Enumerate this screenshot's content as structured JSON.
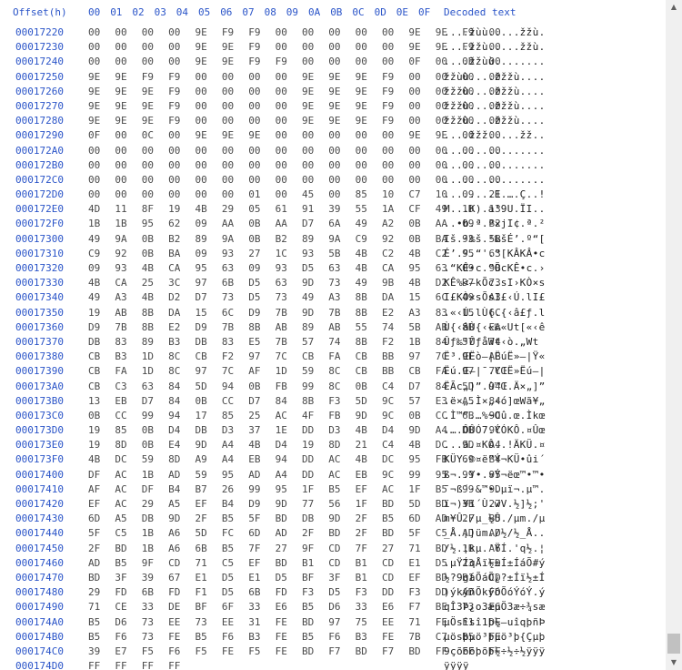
{
  "header": {
    "offset_label": "Offset(h)",
    "columns": [
      "00",
      "01",
      "02",
      "03",
      "04",
      "05",
      "06",
      "07",
      "08",
      "09",
      "0A",
      "0B",
      "0C",
      "0D",
      "0E",
      "0F"
    ],
    "decoded_label": "Decoded text"
  },
  "rows": [
    {
      "offset": "00017220",
      "bytes": "00 00 00 00 9E F9 F9 00 00 00 00 00 9E 9E F9 00",
      "decoded": "....žùù.....žžù."
    },
    {
      "offset": "00017230",
      "bytes": "00 00 00 00 9E 9E F9 00 00 00 00 00 9E 9E F9 00",
      "decoded": "....žžù.....žžù."
    },
    {
      "offset": "00017240",
      "bytes": "00 00 00 00 9E 9E F9 F9 00 00 00 00 0F 00 0B 00",
      "decoded": "....žžùù........"
    },
    {
      "offset": "00017250",
      "bytes": "9E 9E F9 F9 00 00 00 00 9E 9E 9E F9 00 00 00 00",
      "decoded": "žžùù....žžžù...."
    },
    {
      "offset": "00017260",
      "bytes": "9E 9E 9E F9 00 00 00 00 9E 9E 9E F9 00 00 00 00",
      "decoded": "žžžù....žžžù...."
    },
    {
      "offset": "00017270",
      "bytes": "9E 9E 9E F9 00 00 00 00 9E 9E 9E F9 00 00 00 00",
      "decoded": "žžžù....žžžù...."
    },
    {
      "offset": "00017280",
      "bytes": "9E 9E 9E F9 00 00 00 00 9E 9E 9E F9 00 00 00 00",
      "decoded": "žžžù....žžžù...."
    },
    {
      "offset": "00017290",
      "bytes": "0F 00 0C 00 9E 9E 9E 00 00 00 00 00 9E 9E 00 00",
      "decoded": "....žžž.....žž.."
    },
    {
      "offset": "000172A0",
      "bytes": "00 00 00 00 00 00 00 00 00 00 00 00 00 00 00 00",
      "decoded": "................"
    },
    {
      "offset": "000172B0",
      "bytes": "00 00 00 00 00 00 00 00 00 00 00 00 00 00 00 00",
      "decoded": "................"
    },
    {
      "offset": "000172C0",
      "bytes": "00 00 00 00 00 00 00 00 00 00 00 00 00 00 00 00",
      "decoded": "................"
    },
    {
      "offset": "000172D0",
      "bytes": "00 00 00 00 00 00 01 00 45 00 85 10 C7 10 09 21",
      "decoded": "........E.….Ç..!"
    },
    {
      "offset": "000172E0",
      "bytes": "4D 11 8F 19 4B 29 05 61 91 39 55 1A CF 49 1D 13",
      "decoded": "M...K).a‘9U.ÏI.."
    },
    {
      "offset": "000172F0",
      "bytes": "1B 1B 95 62 09 AA 0B AA D7 6A 49 A2 0B AA 09 B2",
      "decoded": "..•b.ª.ª×jI¢.ª.²"
    },
    {
      "offset": "00017300",
      "bytes": "49 9A 0B B2 89 9A 0B B2 89 9A C9 92 0B BA 93 5B",
      "decoded": "Iš.²‰š.²‰šÉ’.º“["
    },
    {
      "offset": "00017310",
      "bytes": "C9 92 0B BA 09 93 27 1C 93 5B 4B C2 4B C2 95 63",
      "decoded": "É’.º.“'.“[KÂKÂ•c"
    },
    {
      "offset": "00017320",
      "bytes": "09 93 4B CA 95 63 09 93 D5 63 4B CA 95 63 09 9B",
      "decoded": ".“KÊ•c.“ÕcKÊ•c.›"
    },
    {
      "offset": "00017330",
      "bytes": "4B CA 25 3C 97 6B D5 63 9D 73 49 9B 4B D2 D7 73",
      "decoded": "KÊ%<—kÕc.sI›KÒ×s"
    },
    {
      "offset": "00017340",
      "bytes": "49 A3 4B D2 D7 73 D5 73 49 A3 8B DA 15 6C 49 A3",
      "decoded": "I£KÒ×sÕsI£‹Ú.lI£"
    },
    {
      "offset": "00017350",
      "bytes": "19 AB 8B DA 15 6C D9 7B 9D 7B 8B E2 A3 83 15 6C",
      "decoded": ".«‹Ú.lÙ{.{‹â£ƒ.l"
    },
    {
      "offset": "00017360",
      "bytes": "D9 7B 8B E2 D9 7B 8B AB 89 AB 55 74 5B AB 8B EA",
      "decoded": "Ù{‹âÙ{‹«‰«Ut[«‹ê"
    },
    {
      "offset": "00017370",
      "bytes": "DB 83 89 B3 DB 83 E5 7B 57 74 8B F2 1B 84 57 74",
      "decoded": "Ûƒ‰³ÛƒåWt‹ò.„Wt"
    },
    {
      "offset": "00017380",
      "bytes": "CB B3 1D 8C CB F2 97 7C CB FA CB BB 97 7C 9F AB",
      "decoded": "Ë³.ŒËò—|ËúË»—|Ÿ«"
    },
    {
      "offset": "00017390",
      "bytes": "CB FA 1D 8C 97 7C AF 1D 59 8C CB BB CB FA 97 7C",
      "decoded": "Ëú.Œ—|¯.YŒË»Ëú—|"
    },
    {
      "offset": "000173A0",
      "bytes": "CB C3 63 84 5D 94 0B FB 99 8C 0B C4 D7 84 5D 94",
      "decoded": "ËÃc„]”.û™Œ.Ä×„]”"
    },
    {
      "offset": "000173B0",
      "bytes": "13 EB D7 84 0B CC D7 84 8B F3 5D 9C 57 E3 A5 84",
      "decoded": ".ë×„.Ì×„‹ó]œWã¥„"
    },
    {
      "offset": "000173C0",
      "bytes": "0B CC 99 94 17 85 25 AC 4F FB 9D 9C 0B CC 6B 9C",
      "decoded": ".Ì™”.…%¬Oû.œ.Ìkœ"
    },
    {
      "offset": "000173D0",
      "bytes": "19 85 0B D4 DB D3 37 1E DD D3 4B D4 9D A4 DB 9C",
      "decoded": ".….ÔÛÓ7.ÝÓKÔ.¤Ûœ"
    },
    {
      "offset": "000173E0",
      "bytes": "19 8D 0B E4 9D A4 4B D4 19 8D 21 C4 4B DC 9D A4",
      "decoded": "...ä.¤KÔ..!ÄKÜ.¤"
    },
    {
      "offset": "000173F0",
      "bytes": "4B DC 59 8D A9 A4 EB 94 DD AC 4B DC 95 FB 69 B4",
      "decoded": "KÜY.©¤ë”Ý¬KÜ•ûi´"
    },
    {
      "offset": "00017400",
      "bytes": "DF AC 1B AD 59 95 AD A4 DD AC EB 9C 99 95 99 95",
      "decoded": "ß¬..Y•.¤Ý¬ëœ™•™•"
    },
    {
      "offset": "00017410",
      "bytes": "AF AC DF B4 B7 26 99 95 1F B5 EF AC 1F B5 99 9D",
      "decoded": "¯¬ß´·&™•.µï¬.µ™."
    },
    {
      "offset": "00017420",
      "bytes": "EF AC 29 A5 EF B4 D9 9D 77 56 1F BD 5D BD 3B 27",
      "decoded": "ï¬)¥ï´Ù.wV.½]½;'"
    },
    {
      "offset": "00017430",
      "bytes": "6D A5 DB 9D 2F B5 5F BD DB 9D 2F B5 6D AD 2F B5",
      "decoded": "m¥Û./µ_½Û./µm./µ"
    },
    {
      "offset": "00017440",
      "bytes": "5F C5 1B A6 5D FC 6D AD 2F BD 2F BD 5F C5 AD AD",
      "decoded": "_Å.¦]üm./½/½_Å.."
    },
    {
      "offset": "00017450",
      "bytes": "2F BD 1B A6 6B B5 7F 27 9F CD 7F 27 71 BD 1B A6",
      "decoded": "/½.¦kµ.'ŸÍ.'q½.¦"
    },
    {
      "offset": "00017460",
      "bytes": "AD B5 9F CD 71 C5 EF BD B1 CD B1 CD E1 D5 23 FD",
      "decoded": ".µŸÍqÅï½±Í±ÍáÕ#ý"
    },
    {
      "offset": "00017470",
      "bytes": "BD 3F 39 67 E1 D5 E1 D5 BF 3F B1 CD EF BD B1 CD",
      "decoded": "½?9gáÕáÕ¿?±Íï½±Í"
    },
    {
      "offset": "00017480",
      "bytes": "29 FD 6B FD F1 D5 6B FD F3 D5 F3 DD F3 DD AD FD",
      "decoded": ")ýkýñÕkýóÕóÝóÝ.ý"
    },
    {
      "offset": "00017490",
      "bytes": "71 CE 33 DE BF 6F 33 E6 B5 D6 33 E6 F7 BE 73 E6",
      "decoded": "qÎ3Þ¿o3æµÖ3æ÷¾sæ"
    },
    {
      "offset": "000174A0",
      "bytes": "B5 D6 73 EE 73 EE 31 FE BD 97 75 EE 71 FE F1 DE",
      "decoded": "µÖsîsî1þ½—uîqþñÞ"
    },
    {
      "offset": "000174B0",
      "bytes": "B5 F6 73 FE B5 F6 B3 FE B5 F6 B3 FE 7B C7 B5 FE",
      "decoded": "µösþµö³þµö³þ{Çµþ"
    },
    {
      "offset": "000174C0",
      "bytes": "39 E7 F5 F6 F5 FE F5 FE BD F7 BD F7 BD FF FF FF",
      "decoded": "9çõöõþõþ½÷½÷½ÿÿÿ"
    },
    {
      "offset": "000174D0",
      "bytes": "FF FF FF FF",
      "decoded": "ÿÿÿÿ"
    }
  ],
  "colors": {
    "offset": "#2a54c8",
    "bytes": "#4a4a4a",
    "decoded": "#222222",
    "background": "#ffffff",
    "scrollbar_track": "#f0f0f0",
    "scrollbar_thumb": "#c1c1c1"
  }
}
